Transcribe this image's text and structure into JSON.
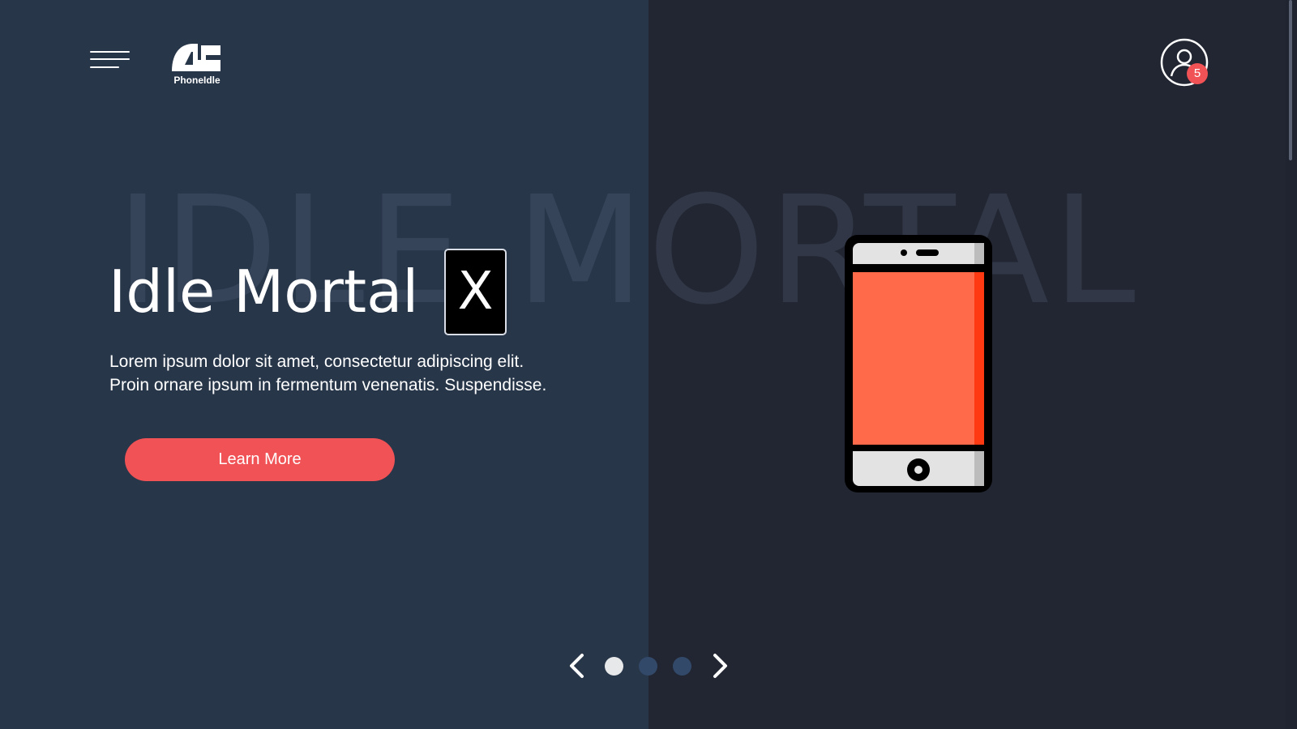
{
  "brand": {
    "name": "PhoneIdle"
  },
  "header": {
    "menu_icon": "hamburger-menu-icon",
    "user_icon": "user-circle-icon",
    "notification_count": "5"
  },
  "hero": {
    "background_word": "IDLE MORTAL",
    "title": "Idle Mortal",
    "title_badge": "X",
    "description": "Lorem ipsum dolor sit amet, consectetur adipiscing elit. Proin ornare ipsum in fermentum venenatis. Suspendisse.",
    "cta_label": "Learn More",
    "illustration": "smartphone-icon"
  },
  "carousel": {
    "prev_icon": "chevron-left-icon",
    "next_icon": "chevron-right-icon",
    "slide_count": 3,
    "active_index": 0
  },
  "colors": {
    "accent": "#f05255",
    "left_bg": "#28364a",
    "right_bg": "#212632",
    "phone_screen": "#ff6b4a"
  }
}
